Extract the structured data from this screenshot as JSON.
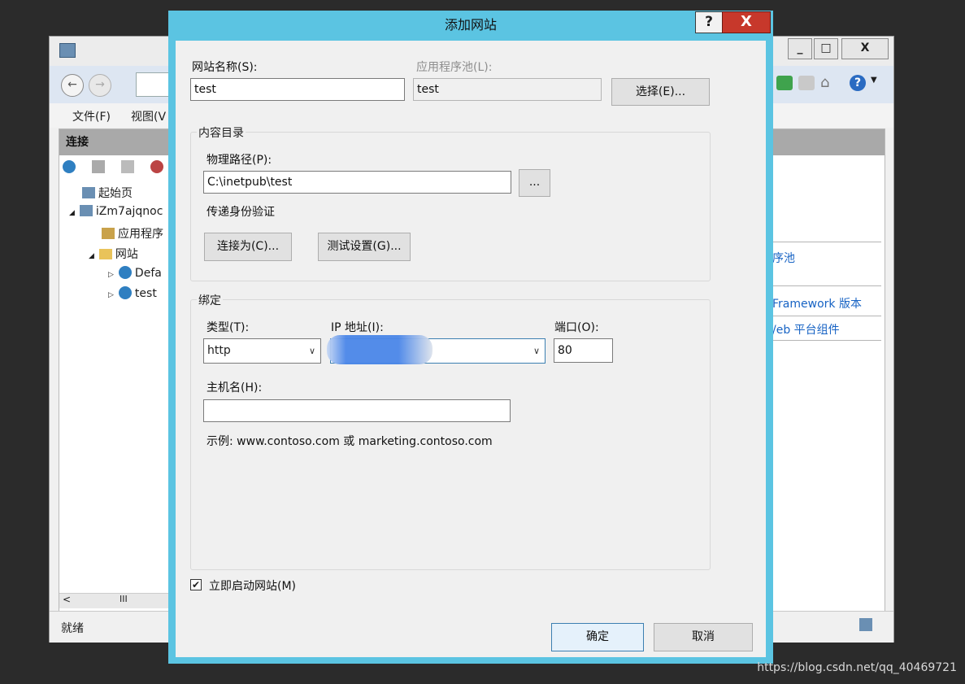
{
  "background_window": {
    "window_buttons": {
      "minimize": "_",
      "maximize": "□",
      "close": "X"
    },
    "nav": {
      "back_icon": "back-arrow-icon",
      "forward_icon": "forward-arrow-icon"
    },
    "menu": {
      "file": "文件(F)",
      "view_partial": "视图(V"
    },
    "left_panel": {
      "header": "连接",
      "tree": [
        {
          "label": "起始页"
        },
        {
          "label": "iZm7ajqnoc"
        },
        {
          "label": "应用程序"
        },
        {
          "label": "网站"
        },
        {
          "label": "Defa"
        },
        {
          "label": "test"
        }
      ],
      "scroll_mid": "III"
    },
    "right_panel": {
      "actions": [
        "序池",
        "Framework 版本",
        "/eb 平台组件"
      ]
    },
    "status": "就绪"
  },
  "dialog": {
    "title": "添加网站",
    "help_label": "?",
    "close_label": "X",
    "site_name": {
      "label": "网站名称(S):",
      "value": "test"
    },
    "app_pool": {
      "label": "应用程序池(L):",
      "value": "test",
      "select_button": "选择(E)..."
    },
    "content_dir": {
      "title": "内容目录",
      "path_label": "物理路径(P):",
      "path_value": "C:\\inetpub\\test",
      "browse_label": "...",
      "passthrough_label": "传递身份验证",
      "connect_as": "连接为(C)...",
      "test_settings": "测试设置(G)..."
    },
    "binding": {
      "title": "绑定",
      "type_label": "类型(T):",
      "type_value": "http",
      "ip_label": "IP 地址(I):",
      "port_label": "端口(O):",
      "port_value": "80",
      "host_label": "主机名(H):",
      "host_value": "",
      "example": "示例: www.contoso.com 或 marketing.contoso.com"
    },
    "start_now": {
      "label": "立即启动网站(M)",
      "checked": true
    },
    "ok": "确定",
    "cancel": "取消"
  },
  "watermark": "https://blog.csdn.net/qq_40469721"
}
